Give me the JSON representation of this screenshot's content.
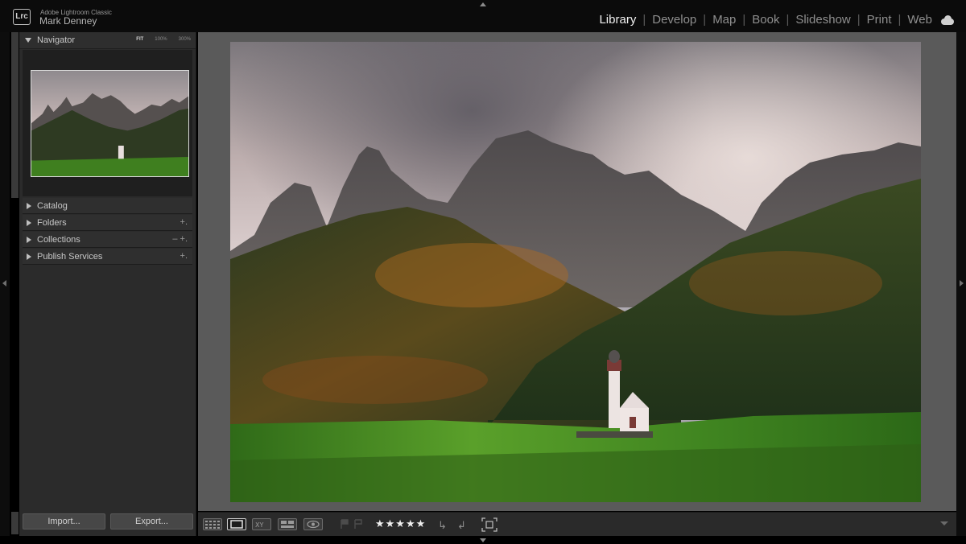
{
  "app": {
    "logo": "Lrc",
    "name": "Adobe Lightroom Classic",
    "user": "Mark Denney"
  },
  "modules": [
    "Library",
    "Develop",
    "Map",
    "Book",
    "Slideshow",
    "Print",
    "Web"
  ],
  "active_module": "Library",
  "navigator": {
    "title": "Navigator",
    "zoom_options": [
      "FIT",
      "100%",
      "300%"
    ],
    "selected_zoom": "FIT"
  },
  "panels": [
    {
      "label": "Catalog",
      "controls": ""
    },
    {
      "label": "Folders",
      "controls": "+."
    },
    {
      "label": "Collections",
      "controls": "– +."
    },
    {
      "label": "Publish Services",
      "controls": "+."
    }
  ],
  "buttons": {
    "import": "Import...",
    "export": "Export..."
  },
  "toolbar": {
    "rating": "★★★★★",
    "view_icons": [
      "grid-view-icon",
      "loupe-view-icon",
      "compare-view-icon",
      "survey-view-icon",
      "people-view-icon"
    ]
  },
  "colors": {
    "accent_active": "#f0f0f0",
    "panel_bg": "#2b2b2b",
    "main_bg": "#5a5a5a"
  }
}
